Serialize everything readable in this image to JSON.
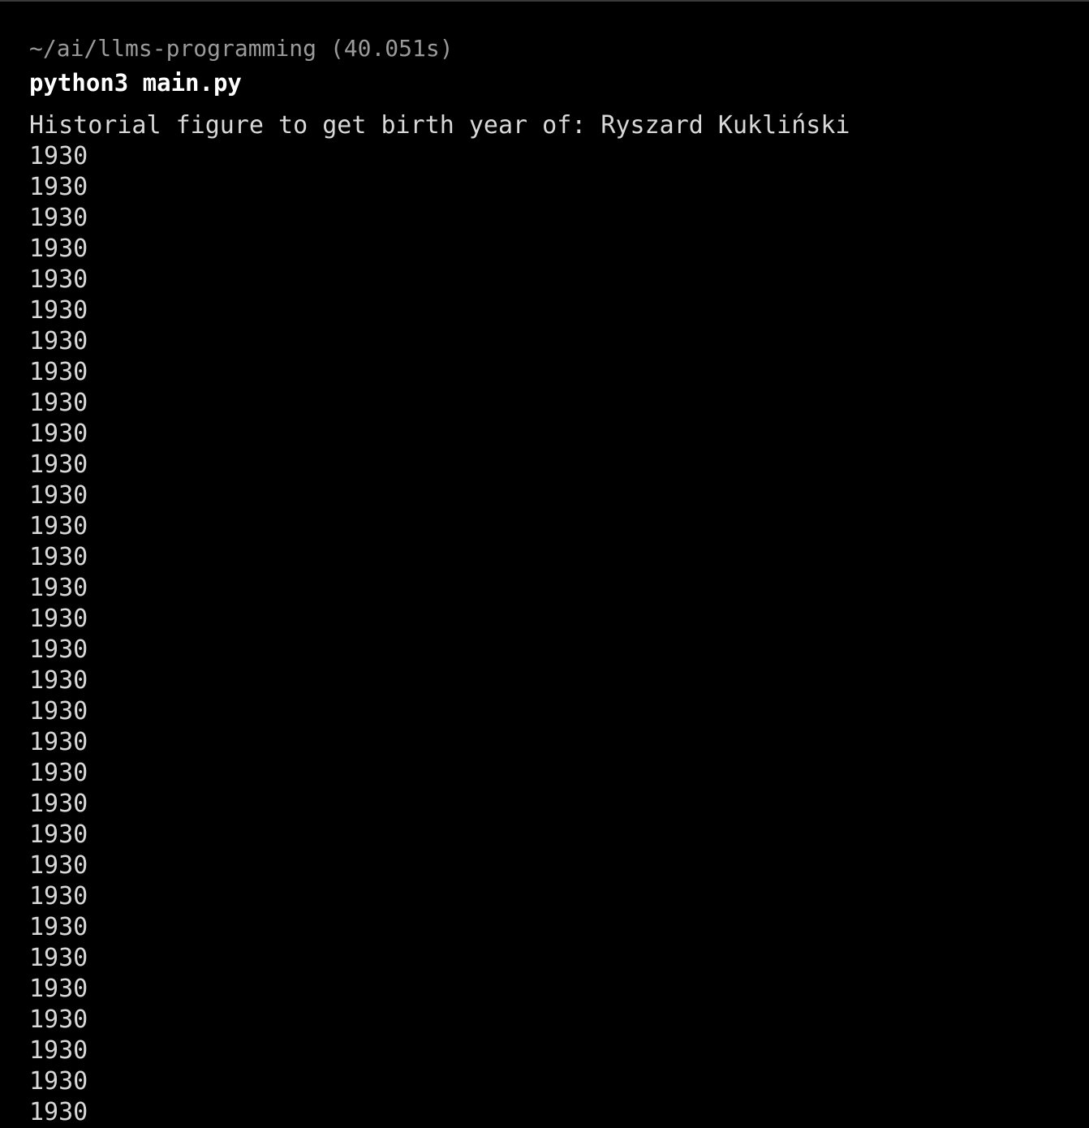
{
  "terminal": {
    "prompt": {
      "path": "~/ai/llms-programming",
      "duration": "(40.051s)"
    },
    "command": "python3 main.py",
    "output": {
      "input_prompt": "Historial figure to get birth year of: ",
      "input_value": "Ryszard Kukliński",
      "lines": [
        "1930",
        "1930",
        "1930",
        "1930",
        "1930",
        "1930",
        "1930",
        "1930",
        "1930",
        "1930",
        "1930",
        "1930",
        "1930",
        "1930",
        "1930",
        "1930",
        "1930",
        "1930",
        "1930",
        "1930",
        "1930",
        "1930",
        "1930",
        "1930",
        "1930",
        "1930",
        "1930",
        "1930",
        "1930",
        "1930",
        "1930",
        "1930"
      ]
    }
  },
  "colors": {
    "background": "#000000",
    "prompt": "#9a9a9a",
    "command": "#ffffff",
    "output": "#d8d8d8"
  }
}
